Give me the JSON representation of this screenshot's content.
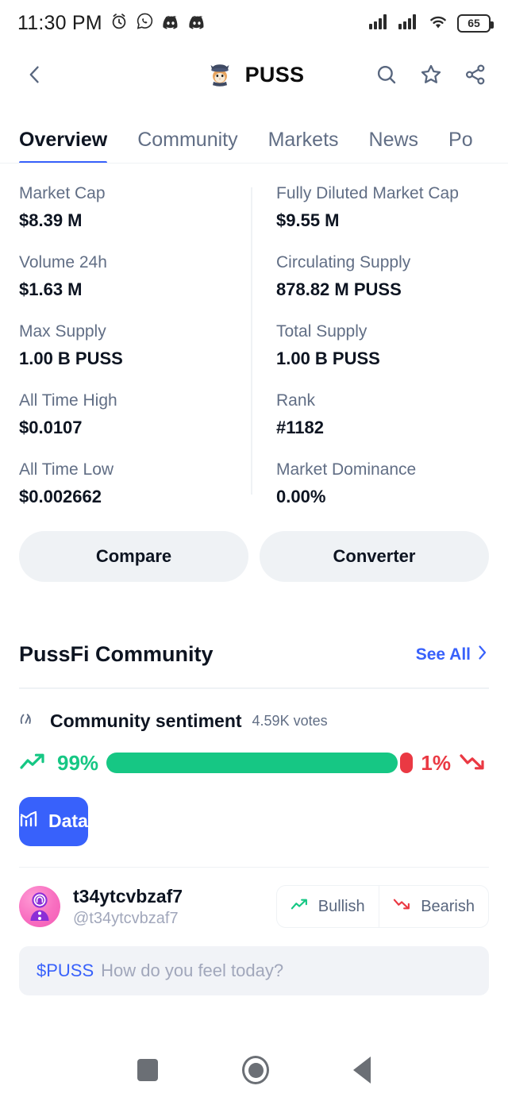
{
  "statusbar": {
    "time": "11:30 PM",
    "icons": [
      "alarm-icon",
      "whatsapp-icon",
      "discord-icon",
      "discord-icon"
    ],
    "battery_level": "65",
    "right_icons": [
      "signal-bars-icon",
      "signal-bars-icon",
      "wifi-icon",
      "battery-icon"
    ]
  },
  "header": {
    "back_label": "chevron-left-icon",
    "coin_symbol": "PUSS",
    "logo": "cat-in-hat-logo",
    "actions": [
      {
        "name": "search-icon"
      },
      {
        "name": "star-icon"
      },
      {
        "name": "share-icon"
      }
    ]
  },
  "tabs": [
    {
      "label": "Overview",
      "active": true
    },
    {
      "label": "Community",
      "active": false
    },
    {
      "label": "Markets",
      "active": false
    },
    {
      "label": "News",
      "active": false
    },
    {
      "label": "Po",
      "active": false
    }
  ],
  "stats": {
    "left": [
      {
        "label": "Market Cap",
        "value": "$8.39 M"
      },
      {
        "label": "Volume 24h",
        "value": "$1.63 M"
      },
      {
        "label": "Max Supply",
        "value": "1.00 B PUSS"
      },
      {
        "label": "All Time High",
        "value": "$0.0107"
      },
      {
        "label": "All Time Low",
        "value": "$0.002662"
      }
    ],
    "right": [
      {
        "label": "Fully Diluted Market Cap",
        "value": "$9.55 M"
      },
      {
        "label": "Circulating Supply",
        "value": "878.82 M PUSS"
      },
      {
        "label": "Total Supply",
        "value": "1.00 B PUSS"
      },
      {
        "label": "Rank",
        "value": "#1182"
      },
      {
        "label": "Market Dominance",
        "value": "0.00%"
      }
    ]
  },
  "actions": {
    "compare_label": "Compare",
    "converter_label": "Converter"
  },
  "community": {
    "section_title": "PussFi Community",
    "see_all_label": "See All",
    "sentiment": {
      "title": "Community sentiment",
      "votes": "4.59K votes",
      "bullish_pct": "99%",
      "bearish_pct": "1%",
      "bullish_value": 99,
      "bearish_value": 1
    },
    "data_button_label": "Data",
    "user": {
      "name": "t34ytcvbzaf7",
      "handle": "@t34ytcvbzaf7"
    },
    "toggle": {
      "bullish_label": "Bullish",
      "bearish_label": "Bearish"
    },
    "composer": {
      "ticker": "$PUSS",
      "placeholder": "How do you feel today?"
    }
  },
  "colors": {
    "accent_blue": "#3861fb",
    "bullish_green": "#16c784",
    "bearish_red": "#ea3943",
    "muted_text": "#616e85",
    "surface_gray": "#eff2f5"
  },
  "navbar": {
    "recents": "square-icon",
    "home": "circle-icon",
    "back": "triangle-back-icon"
  }
}
